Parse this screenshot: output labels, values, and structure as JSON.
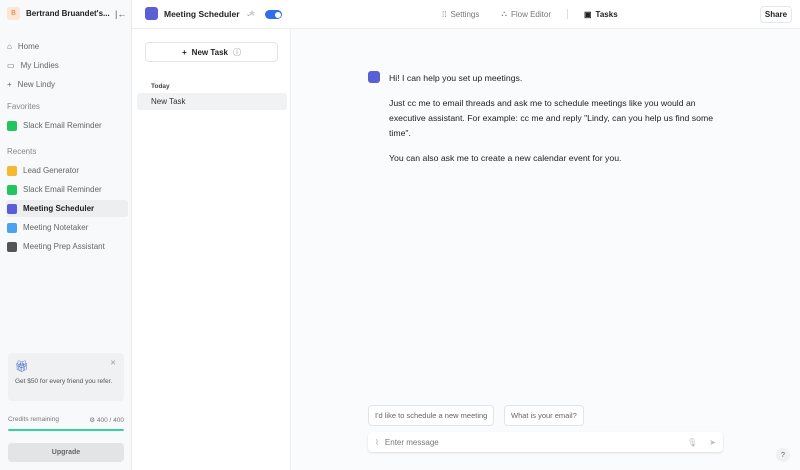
{
  "sidebar": {
    "workspace": {
      "initial": "B",
      "name": "Bertrand Bruandet's..."
    },
    "nav": [
      {
        "label": "Home",
        "icon": "home-icon"
      },
      {
        "label": "My Lindies",
        "icon": "folder-icon"
      },
      {
        "label": "New Lindy",
        "icon": "plus-icon"
      }
    ],
    "favorites_label": "Favorites",
    "favorites": [
      {
        "label": "Slack Email Reminder",
        "color": "#22c55e"
      }
    ],
    "recents_label": "Recents",
    "recents": [
      {
        "label": "Lead Generator",
        "color": "#f5b82e"
      },
      {
        "label": "Slack Email Reminder",
        "color": "#22c55e"
      },
      {
        "label": "Meeting Scheduler",
        "color": "#5b5fd6",
        "active": true
      },
      {
        "label": "Meeting Notetaker",
        "color": "#4aa3f0"
      },
      {
        "label": "Meeting Prep Assistant",
        "color": "#555555"
      }
    ],
    "promo": {
      "text": "Get $50 for every friend you refer."
    },
    "credits": {
      "label": "Credits remaining",
      "value": "400 / 400",
      "fraction": 1.0
    },
    "upgrade": "Upgrade"
  },
  "topbar": {
    "agent_name": "Meeting Scheduler",
    "toggle_on": true,
    "tabs": [
      "Settings",
      "Flow Editor",
      "Tasks"
    ],
    "active_tab": "Tasks",
    "share": "Share"
  },
  "tasks": {
    "new_task": "New Task",
    "group": "Today",
    "items": [
      "New Task"
    ]
  },
  "chat": {
    "messages": [
      "Hi! I can help you set up meetings.",
      "Just cc me to email threads and ask me to schedule meetings like you would an executive assistant. For example: cc me and reply \"Lindy, can you help us find some time\".",
      "You can also ask me to create a new calendar event for you."
    ],
    "suggestions": [
      "I'd like to schedule a new meeting",
      "What is your email?"
    ],
    "input_placeholder": "Enter message",
    "help": "?"
  }
}
